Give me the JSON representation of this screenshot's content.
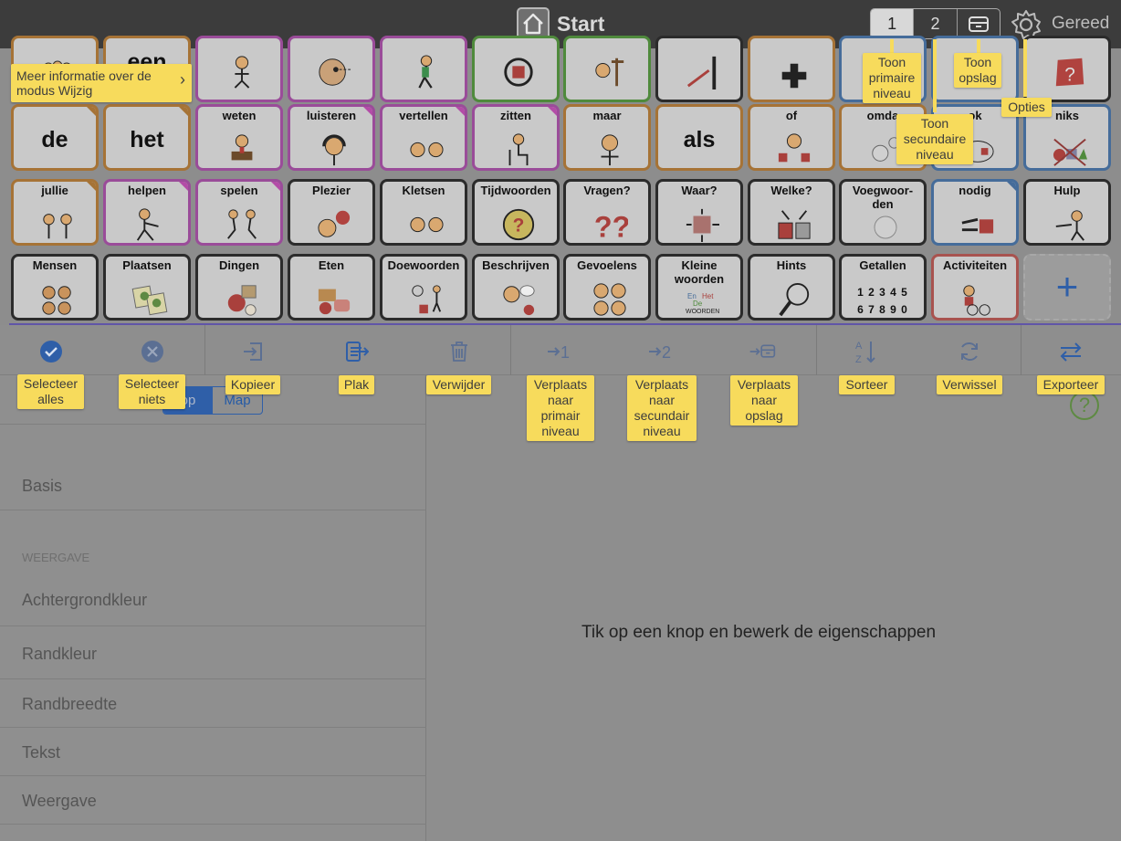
{
  "header": {
    "title": "Start",
    "levels": [
      "1",
      "2"
    ],
    "done": "Gereed"
  },
  "grid": {
    "row1": [
      "een"
    ],
    "row2": [
      "de",
      "het",
      "weten",
      "luisteren",
      "vertellen",
      "zitten",
      "maar",
      "als",
      "of",
      "omda",
      "ok",
      "niks"
    ],
    "row3": [
      "jullie",
      "helpen",
      "spelen",
      "Plezier",
      "Kletsen",
      "Tijdwoorden",
      "Vragen?",
      "Waar?",
      "Welke?",
      "Voegwoor-\nden",
      "nodig",
      "Hulp"
    ],
    "row4": [
      "Mensen",
      "Plaatsen",
      "Dingen",
      "Eten",
      "Doewoorden",
      "Beschrijven",
      "Gevoelens",
      "Kleine\nwoorden",
      "Hints",
      "Getallen",
      "Activiteiten",
      "+"
    ]
  },
  "toolbar": {
    "select_all": "Selecteer\nalles",
    "select_none": "Selecteer\nniets",
    "copy": "Kopieer",
    "paste": "Plak",
    "delete": "Verwijder",
    "move_primary": "Verplaats\nnaar\nprimair\nniveau",
    "move_secondary": "Verplaats\nnaar\nsecundair\nniveau",
    "move_storage": "Verplaats\nnaar\nopslag",
    "sort": "Sorteer",
    "swap": "Verwissel",
    "export": "Exporteer"
  },
  "tooltips": {
    "info": "Meer informatie over de\nmodus Wijzig",
    "show_primary": "Toon\nprimaire\nniveau",
    "show_secondary": "Toon\nsecundaire\nniveau",
    "show_storage": "Toon\nopslag",
    "options": "Opties"
  },
  "panel": {
    "segments": [
      "op",
      "Map"
    ],
    "items": [
      "Basis",
      "Achtergrondkleur",
      "Randkleur",
      "Randbreedte",
      "Tekst",
      "Weergave"
    ],
    "section_header": "WEERGAVE",
    "message": "Tik op een knop en bewerk de eigenschappen"
  },
  "cell_pics": {
    "getallen": "1 2 3 4 5\n6 7 8 9 0"
  },
  "colors": {
    "accent": "#2f5fa8",
    "tooltip": "#f7db5c",
    "topbar": "#3c3c3c"
  }
}
